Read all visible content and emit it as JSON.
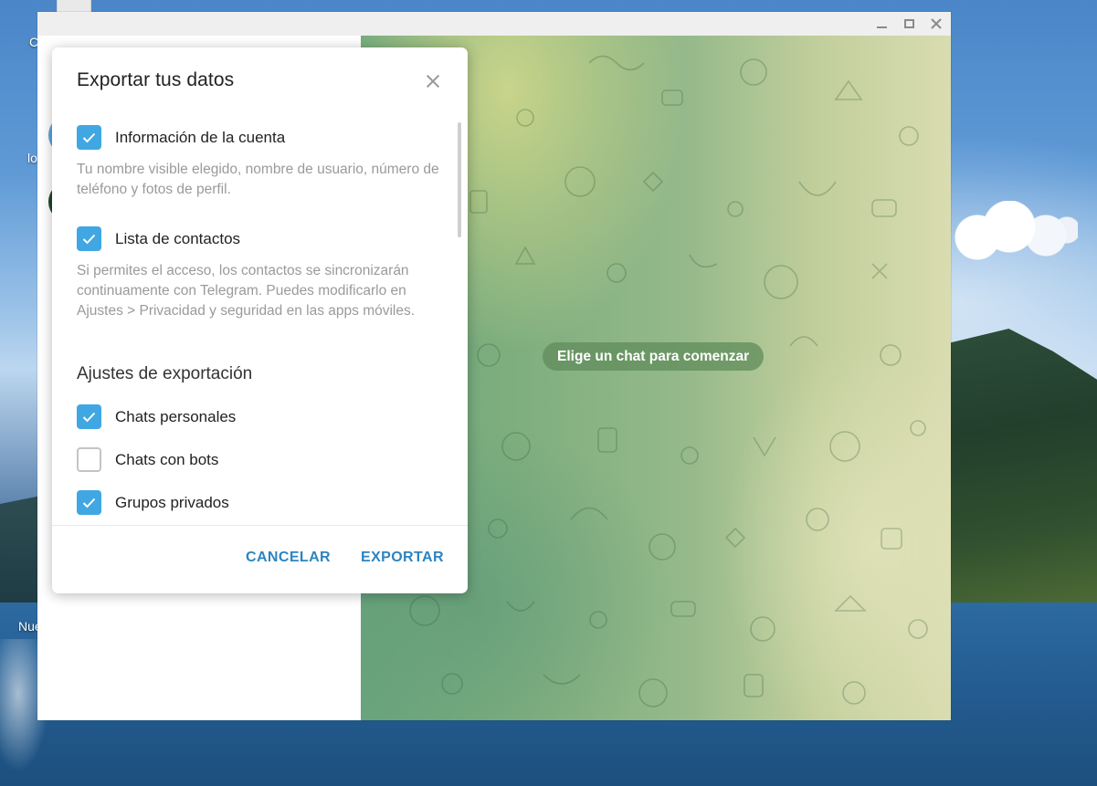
{
  "desktop": {
    "label_a": "C",
    "label_b": "lo",
    "label_c": "Nue"
  },
  "window": {
    "controls": {
      "minimize": "minimize",
      "maximize": "maximize",
      "close": "close"
    }
  },
  "chat": {
    "empty_prompt": "Elige un chat para comenzar"
  },
  "dialog": {
    "title": "Exportar tus datos",
    "items": [
      {
        "label": "Información de la cuenta",
        "checked": true,
        "description": "Tu nombre visible elegido, nombre de usuario, número de teléfono y fotos de perfil."
      },
      {
        "label": "Lista de contactos",
        "checked": true,
        "description": "Si permites el acceso, los contactos se sincronizarán continuamente con Telegram. Puedes modificarlo en Ajustes > Privacidad y seguridad en las apps móviles."
      }
    ],
    "section_title": "Ajustes de exportación",
    "export_options": [
      {
        "label": "Chats personales",
        "checked": true
      },
      {
        "label": "Chats con bots",
        "checked": false
      },
      {
        "label": "Grupos privados",
        "checked": true
      }
    ],
    "cancel_label": "CANCELAR",
    "export_label": "EXPORTAR"
  },
  "colors": {
    "accent": "#40a7e3",
    "button_text": "#2e84c0"
  }
}
